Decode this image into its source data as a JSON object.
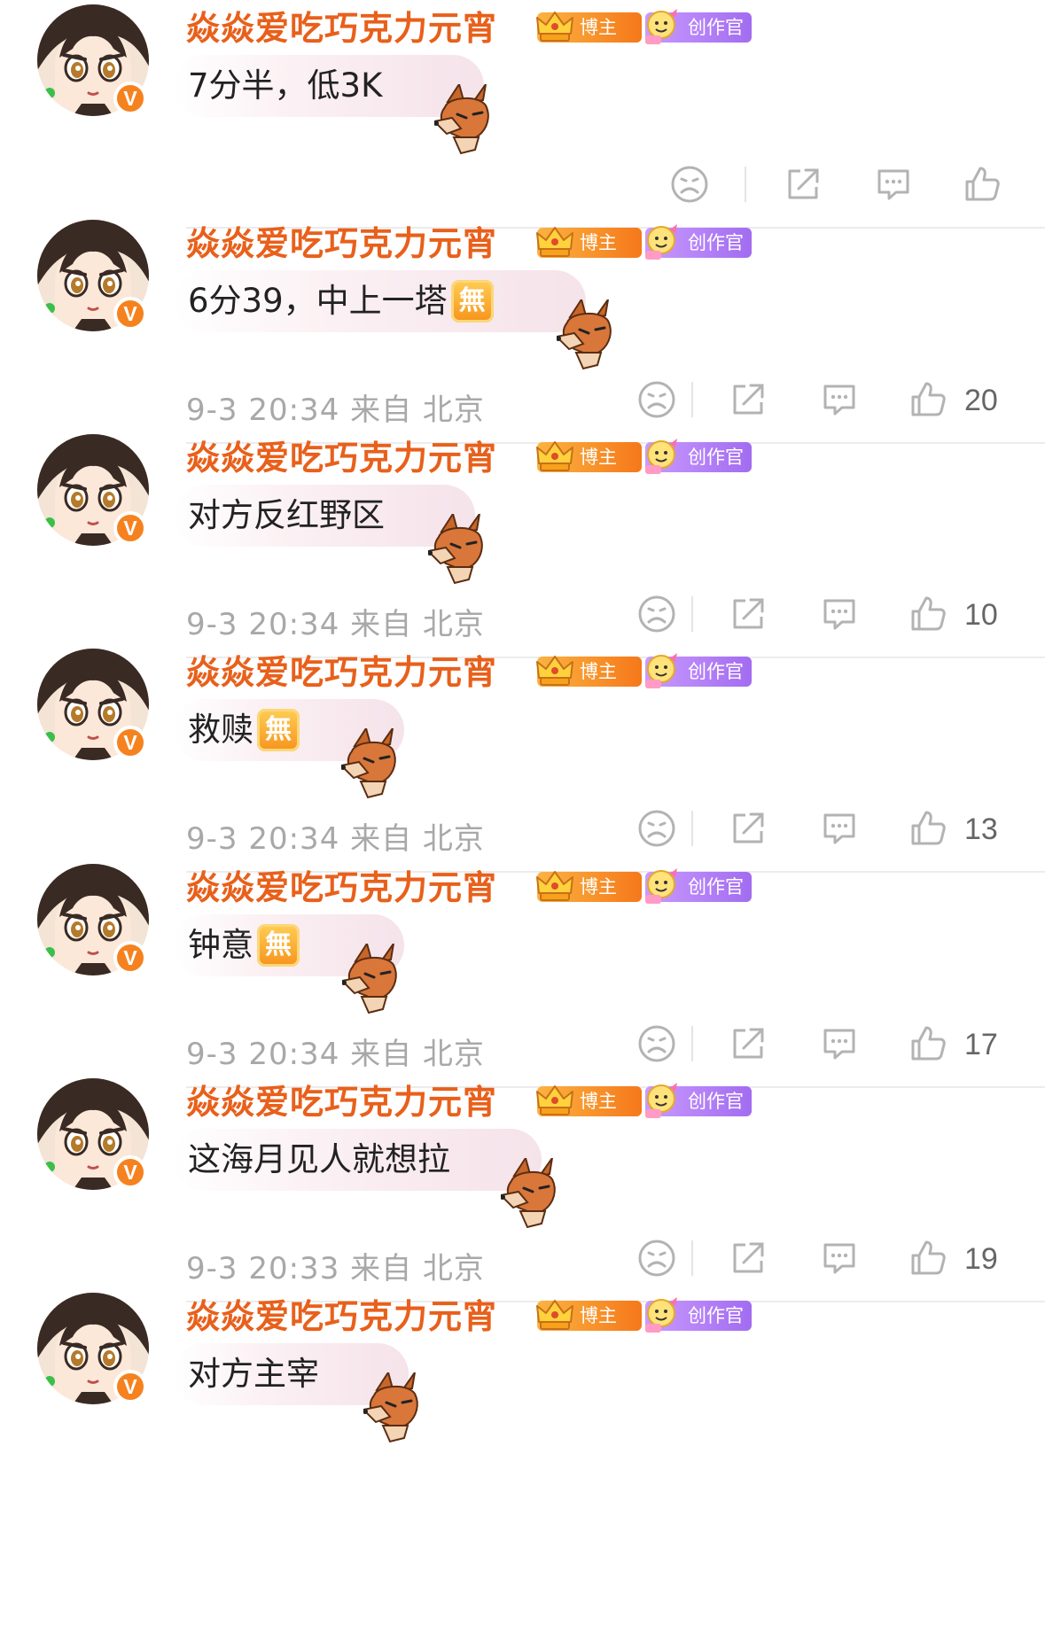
{
  "comments": [
    {
      "username": "焱焱爱吃巧克力元宵",
      "verified_badge": "V",
      "tags": [
        "博主",
        "创作官"
      ],
      "text": "7分半，低3K",
      "has_emoji": false,
      "meta": "",
      "likes": ""
    },
    {
      "username": "焱焱爱吃巧克力元宵",
      "verified_badge": "V",
      "tags": [
        "博主",
        "创作官"
      ],
      "text": "6分39，中上一塔",
      "has_emoji": true,
      "emoji_char": "無",
      "meta": "9-3 20:34 来自 北京",
      "likes": "20"
    },
    {
      "username": "焱焱爱吃巧克力元宵",
      "verified_badge": "V",
      "tags": [
        "博主",
        "创作官"
      ],
      "text": "对方反红野区",
      "has_emoji": false,
      "meta": "9-3 20:34 来自 北京",
      "likes": "10"
    },
    {
      "username": "焱焱爱吃巧克力元宵",
      "verified_badge": "V",
      "tags": [
        "博主",
        "创作官"
      ],
      "text": "救赎",
      "has_emoji": true,
      "emoji_char": "無",
      "meta": "9-3 20:34 来自 北京",
      "likes": "13"
    },
    {
      "username": "焱焱爱吃巧克力元宵",
      "verified_badge": "V",
      "tags": [
        "博主",
        "创作官"
      ],
      "text": "钟意",
      "has_emoji": true,
      "emoji_char": "無",
      "meta": "9-3 20:34 来自 北京",
      "likes": "17"
    },
    {
      "username": "焱焱爱吃巧克力元宵",
      "verified_badge": "V",
      "tags": [
        "博主",
        "创作官"
      ],
      "text": "这海月见人就想拉",
      "has_emoji": false,
      "meta": "9-3 20:33 来自 北京",
      "likes": "19"
    },
    {
      "username": "焱焱爱吃巧克力元宵",
      "verified_badge": "V",
      "tags": [
        "博主",
        "创作官"
      ],
      "text": "对方主宰",
      "has_emoji": false,
      "meta": "",
      "likes": ""
    }
  ],
  "icons": {
    "dislike": "sad-face-icon",
    "share": "share-icon",
    "comment": "comment-icon",
    "like": "thumbs-up-icon",
    "bubble_decoration": "fox-icon"
  },
  "colors": {
    "username": "#e8601b",
    "verified": "#f5821f",
    "meta": "#a8a8a8",
    "tag_blogger": "#f7921e",
    "tag_creator": "#b17ff4"
  }
}
